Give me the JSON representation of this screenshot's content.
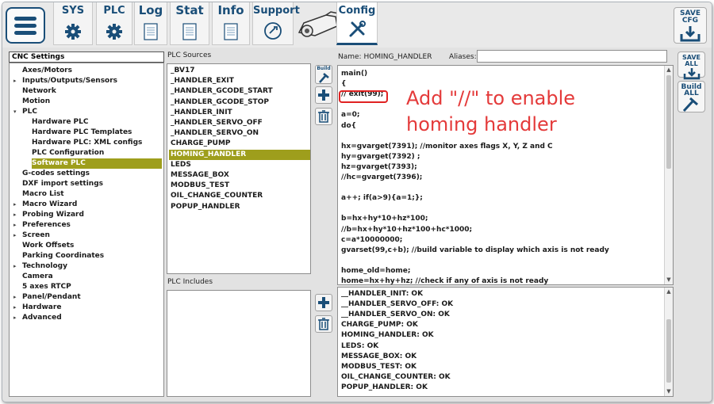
{
  "toolbar": {
    "tabs": [
      {
        "label": "SYS",
        "icon": "gear-icon"
      },
      {
        "label": "PLC",
        "icon": "gear-icon"
      },
      {
        "label": "Log",
        "icon": "document-icon"
      },
      {
        "label": "Stat",
        "icon": "document-icon"
      },
      {
        "label": "Info",
        "icon": "document-icon"
      },
      {
        "label": "Support",
        "icon": "support-icon"
      },
      {
        "label": "Config",
        "icon": "tools-icon"
      }
    ],
    "save_cfg": "SAVE CFG",
    "active_tab": "Config"
  },
  "sidebar": {
    "title": "CNC Settings",
    "items": [
      {
        "label": "Axes/Motors",
        "level": 1,
        "arrow": ""
      },
      {
        "label": "Inputs/Outputs/Sensors",
        "level": 1,
        "arrow": "▸"
      },
      {
        "label": "Network",
        "level": 1,
        "arrow": ""
      },
      {
        "label": "Motion",
        "level": 1,
        "arrow": ""
      },
      {
        "label": "PLC",
        "level": 1,
        "arrow": "▾"
      },
      {
        "label": "Hardware PLC",
        "level": 2,
        "arrow": ""
      },
      {
        "label": "Hardware PLC Templates",
        "level": 2,
        "arrow": ""
      },
      {
        "label": "Hardware PLC: XML configs",
        "level": 2,
        "arrow": ""
      },
      {
        "label": "PLC Configuration",
        "level": 2,
        "arrow": ""
      },
      {
        "label": "Software PLC",
        "level": 2,
        "arrow": "",
        "selected": true
      },
      {
        "label": "G-codes settings",
        "level": 1,
        "arrow": ""
      },
      {
        "label": "DXF import settings",
        "level": 1,
        "arrow": ""
      },
      {
        "label": "Macro List",
        "level": 1,
        "arrow": ""
      },
      {
        "label": "Macro Wizard",
        "level": 1,
        "arrow": "▸"
      },
      {
        "label": "Probing Wizard",
        "level": 1,
        "arrow": "▸"
      },
      {
        "label": "Preferences",
        "level": 1,
        "arrow": "▸"
      },
      {
        "label": "Screen",
        "level": 1,
        "arrow": "▸"
      },
      {
        "label": "Work Offsets",
        "level": 1,
        "arrow": ""
      },
      {
        "label": "Parking Coordinates",
        "level": 1,
        "arrow": ""
      },
      {
        "label": "Technology",
        "level": 1,
        "arrow": "▸"
      },
      {
        "label": "Camera",
        "level": 1,
        "arrow": ""
      },
      {
        "label": "5 axes RTCP",
        "level": 1,
        "arrow": ""
      },
      {
        "label": "Panel/Pendant",
        "level": 1,
        "arrow": "▸"
      },
      {
        "label": "Hardware",
        "level": 1,
        "arrow": "▸"
      },
      {
        "label": "Advanced",
        "level": 1,
        "arrow": "▸"
      }
    ]
  },
  "plc_sources": {
    "caption": "PLC Sources",
    "items": [
      {
        "label": "_BV17"
      },
      {
        "label": "_HANDLER_EXIT"
      },
      {
        "label": "_HANDLER_GCODE_START"
      },
      {
        "label": "_HANDLER_GCODE_STOP"
      },
      {
        "label": "_HANDLER_INIT"
      },
      {
        "label": "_HANDLER_SERVO_OFF"
      },
      {
        "label": "_HANDLER_SERVO_ON"
      },
      {
        "label": "CHARGE_PUMP"
      },
      {
        "label": "HOMING_HANDLER",
        "selected": true
      },
      {
        "label": "LEDS"
      },
      {
        "label": "MESSAGE_BOX"
      },
      {
        "label": "MODBUS_TEST"
      },
      {
        "label": "OIL_CHANGE_COUNTER"
      },
      {
        "label": "POPUP_HANDLER"
      }
    ],
    "build_label": "Build"
  },
  "plc_includes": {
    "caption": "PLC Includes"
  },
  "editor": {
    "name_label": "Name:",
    "name_value": "HOMING_HANDLER",
    "aliases_label": "Aliases:",
    "aliases_value": "",
    "code_lines": [
      "main()",
      "{",
      "// exit(99);",
      "",
      "a=0;",
      "do{",
      "",
      "hx=gvarget(7391); //monitor axes flags X, Y, Z and C",
      "hy=gvarget(7392) ;",
      "hz=gvarget(7393);",
      "//hc=gvarget(7396);",
      "",
      "a++; if(a>9){a=1;};",
      "",
      "b=hx+hy*10+hz*100;",
      "//b=hx+hy*10+hz*100+hc*1000;",
      "c=a*10000000;",
      "gvarset(99,c+b); //build variable to display which axis is not ready",
      "",
      "home_old=home;",
      "home=hx+hy+hz; //check if any of axis is not ready"
    ]
  },
  "annotation": {
    "line1": "Add \"//\" to enable",
    "line2": "homing handler",
    "color": "#e43a3a"
  },
  "output": {
    "lines": [
      "__HANDLER_INIT: OK",
      "__HANDLER_SERVO_OFF: OK",
      "__HANDLER_SERVO_ON: OK",
      "CHARGE_PUMP: OK",
      "HOMING_HANDLER: OK",
      "LEDS: OK",
      "MESSAGE_BOX: OK",
      "MODBUS_TEST: OK",
      "OIL_CHANGE_COUNTER: OK",
      "POPUP_HANDLER: OK"
    ]
  },
  "right_buttons": {
    "save_all": "SAVE ALL",
    "build_all": "Build ALL"
  },
  "colors": {
    "accent": "#1a4e78",
    "selection": "#9e9e1c",
    "highlight": "#e02222"
  }
}
